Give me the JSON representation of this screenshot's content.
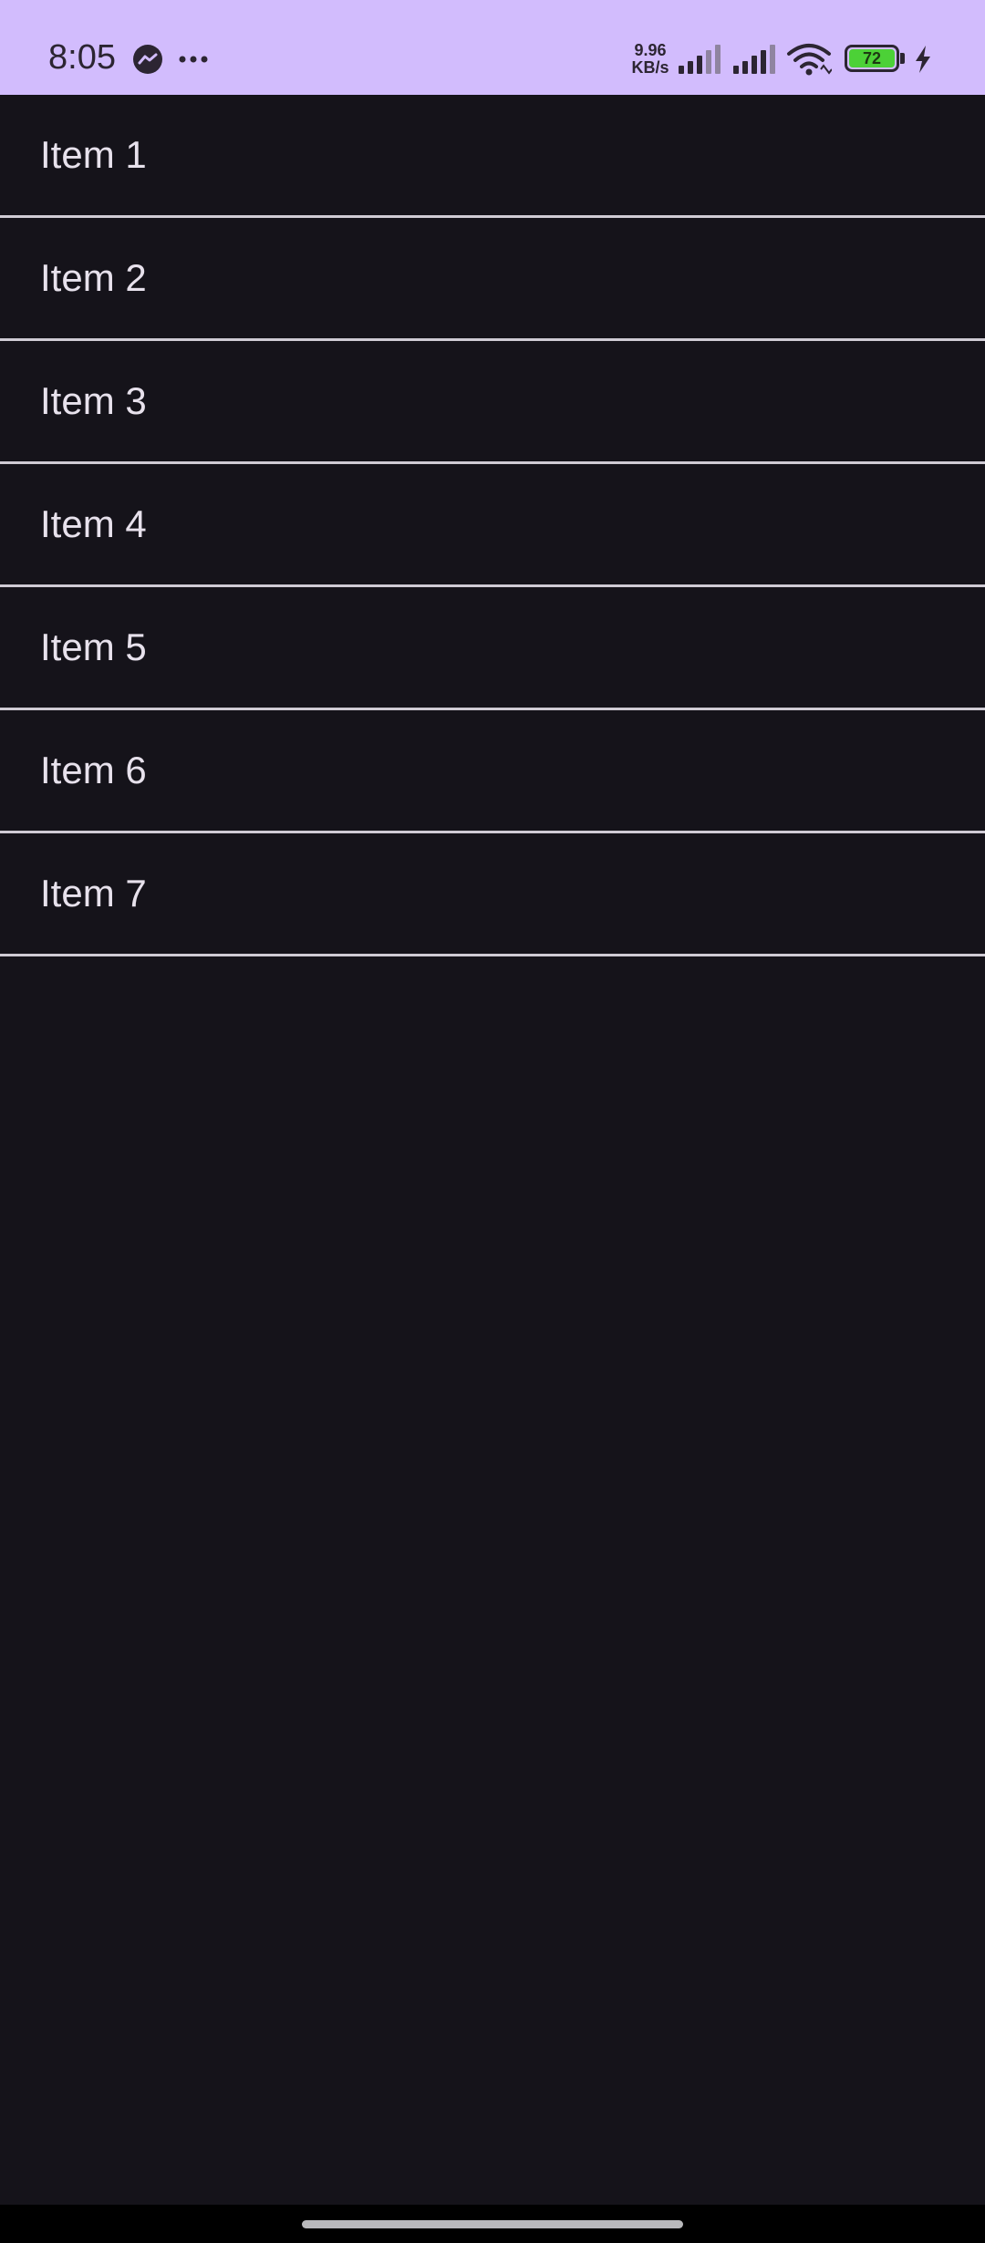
{
  "status_bar": {
    "time": "8:05",
    "net_speed_value": "9.96",
    "net_speed_unit": "KB/s",
    "battery_level": "72",
    "background_color": "#d2bcfd",
    "icons": [
      "messenger-icon",
      "more-icon",
      "signal-icon",
      "signal-icon",
      "wifi-icon",
      "battery-icon",
      "charging-icon"
    ]
  },
  "list": {
    "items": [
      {
        "label": "Item 1"
      },
      {
        "label": "Item 2"
      },
      {
        "label": "Item 3"
      },
      {
        "label": "Item 4"
      },
      {
        "label": "Item 5"
      },
      {
        "label": "Item 6"
      },
      {
        "label": "Item 7"
      }
    ],
    "background_color": "#15131a",
    "divider_color": "#cfcbd4",
    "text_color": "#e7e1ec"
  }
}
